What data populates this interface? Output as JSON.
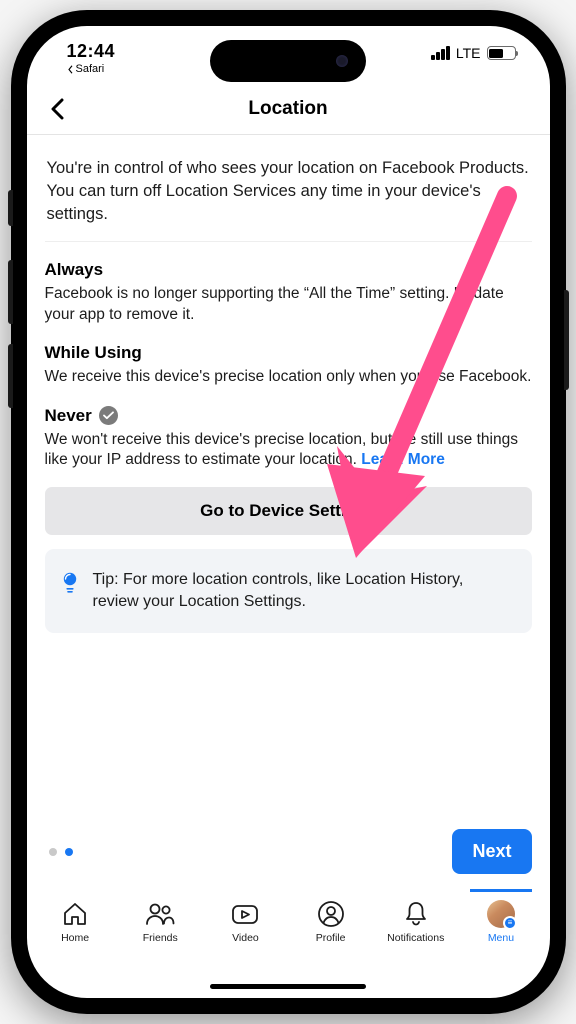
{
  "status_bar": {
    "time": "12:44",
    "back_app": "Safari",
    "network_label": "LTE"
  },
  "header": {
    "title": "Location"
  },
  "intro": "You're in control of who sees your location on Facebook Products. You can turn off Location Services any time in your device's settings.",
  "options": {
    "always": {
      "title": "Always",
      "desc": "Facebook is no longer supporting the “All the Time” setting. Update your app to remove it."
    },
    "while_using": {
      "title": "While Using",
      "desc": "We receive this device's precise location only when you use Facebook."
    },
    "never": {
      "title": "Never",
      "desc": "We won't receive this device's precise location, but we still use things like your IP address to estimate your location.",
      "learn_more": "Learn More"
    }
  },
  "device_button": "Go to Device Settings",
  "tip": {
    "text": "Tip: For more location controls, like Location History, review your Location Settings."
  },
  "footer": {
    "next": "Next"
  },
  "nav": {
    "home": "Home",
    "friends": "Friends",
    "video": "Video",
    "profile": "Profile",
    "notifications": "Notifications",
    "menu": "Menu"
  },
  "annotation": {
    "arrow_color": "#ff4d8d"
  }
}
